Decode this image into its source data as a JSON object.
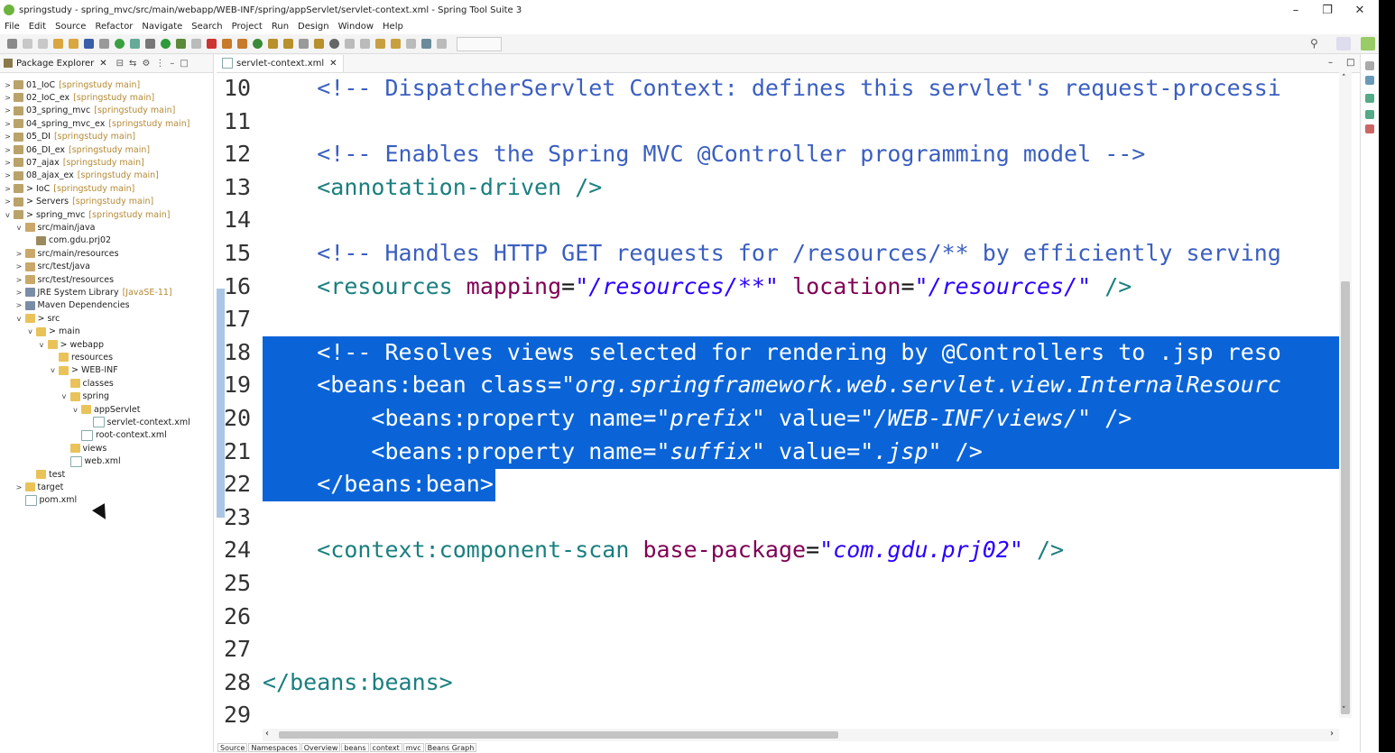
{
  "window": {
    "title": "springstudy - spring_mvc/src/main/webapp/WEB-INF/spring/appServlet/servlet-context.xml - Spring Tool Suite 3",
    "minimize": "–",
    "restore": "❐",
    "close": "✕"
  },
  "menu": [
    "File",
    "Edit",
    "Source",
    "Refactor",
    "Navigate",
    "Search",
    "Project",
    "Run",
    "Design",
    "Window",
    "Help"
  ],
  "package_explorer": {
    "title": "Package Explorer",
    "tree": [
      {
        "indent": 0,
        "tw": ">",
        "icon": "proj",
        "label": "01_IoC",
        "deco": "[springstudy main]"
      },
      {
        "indent": 0,
        "tw": ">",
        "icon": "proj",
        "label": "02_IoC_ex",
        "deco": "[springstudy main]"
      },
      {
        "indent": 0,
        "tw": ">",
        "icon": "proj",
        "label": "03_spring_mvc",
        "deco": "[springstudy main]"
      },
      {
        "indent": 0,
        "tw": ">",
        "icon": "proj",
        "label": "04_spring_mvc_ex",
        "deco": "[springstudy main]"
      },
      {
        "indent": 0,
        "tw": ">",
        "icon": "proj",
        "label": "05_DI",
        "deco": "[springstudy main]"
      },
      {
        "indent": 0,
        "tw": ">",
        "icon": "proj",
        "label": "06_DI_ex",
        "deco": "[springstudy main]"
      },
      {
        "indent": 0,
        "tw": ">",
        "icon": "proj",
        "label": "07_ajax",
        "deco": "[springstudy main]"
      },
      {
        "indent": 0,
        "tw": ">",
        "icon": "proj",
        "label": "08_ajax_ex",
        "deco": "[springstudy main]"
      },
      {
        "indent": 0,
        "tw": ">",
        "icon": "proj",
        "label": "> IoC",
        "deco": "[springstudy main]"
      },
      {
        "indent": 0,
        "tw": ">",
        "icon": "proj",
        "label": "> Servers",
        "deco": "[springstudy main]"
      },
      {
        "indent": 0,
        "tw": "v",
        "icon": "proj",
        "label": "> spring_mvc",
        "deco": "[springstudy main]"
      },
      {
        "indent": 1,
        "tw": "v",
        "icon": "src",
        "label": "src/main/java",
        "deco": ""
      },
      {
        "indent": 2,
        "tw": "",
        "icon": "pkgi",
        "label": "com.gdu.prj02",
        "deco": ""
      },
      {
        "indent": 1,
        "tw": ">",
        "icon": "src",
        "label": "src/main/resources",
        "deco": ""
      },
      {
        "indent": 1,
        "tw": ">",
        "icon": "src",
        "label": "src/test/java",
        "deco": ""
      },
      {
        "indent": 1,
        "tw": ">",
        "icon": "src",
        "label": "src/test/resources",
        "deco": ""
      },
      {
        "indent": 1,
        "tw": ">",
        "icon": "lib",
        "label": "JRE System Library",
        "deco": "[JavaSE-11]"
      },
      {
        "indent": 1,
        "tw": ">",
        "icon": "lib",
        "label": "Maven Dependencies",
        "deco": ""
      },
      {
        "indent": 1,
        "tw": "v",
        "icon": "folder",
        "label": "> src",
        "deco": ""
      },
      {
        "indent": 2,
        "tw": "v",
        "icon": "folder",
        "label": "> main",
        "deco": ""
      },
      {
        "indent": 3,
        "tw": "v",
        "icon": "folder",
        "label": "> webapp",
        "deco": ""
      },
      {
        "indent": 4,
        "tw": "",
        "icon": "folder",
        "label": "resources",
        "deco": ""
      },
      {
        "indent": 4,
        "tw": "v",
        "icon": "folder",
        "label": "> WEB-INF",
        "deco": ""
      },
      {
        "indent": 5,
        "tw": "",
        "icon": "folder",
        "label": "classes",
        "deco": ""
      },
      {
        "indent": 5,
        "tw": "v",
        "icon": "folder",
        "label": "spring",
        "deco": ""
      },
      {
        "indent": 6,
        "tw": "v",
        "icon": "folder",
        "label": "appServlet",
        "deco": ""
      },
      {
        "indent": 7,
        "tw": "",
        "icon": "xml",
        "label": "servlet-context.xml",
        "deco": ""
      },
      {
        "indent": 6,
        "tw": "",
        "icon": "xml",
        "label": "root-context.xml",
        "deco": ""
      },
      {
        "indent": 5,
        "tw": "",
        "icon": "folder",
        "label": "views",
        "deco": ""
      },
      {
        "indent": 5,
        "tw": "",
        "icon": "xml",
        "label": "web.xml",
        "deco": ""
      },
      {
        "indent": 2,
        "tw": "",
        "icon": "folder",
        "label": "test",
        "deco": ""
      },
      {
        "indent": 1,
        "tw": ">",
        "icon": "folder",
        "label": "target",
        "deco": ""
      },
      {
        "indent": 1,
        "tw": "",
        "icon": "xml",
        "label": "pom.xml",
        "deco": ""
      }
    ]
  },
  "editor": {
    "tab": "servlet-context.xml",
    "line_numbers": [
      "10",
      "11",
      "12",
      "13",
      "14",
      "15",
      "16",
      "17",
      "18",
      "19",
      "20",
      "21",
      "22",
      "23",
      "24",
      "25",
      "26",
      "27",
      "28",
      "29"
    ],
    "lines": [
      {
        "segs": [
          {
            "t": "    ",
            "c": "#111"
          },
          {
            "t": "<!-- DispatcherServlet Context: defines this servlet's request-processi",
            "c": "#3b5fc0"
          }
        ]
      },
      {
        "segs": []
      },
      {
        "segs": [
          {
            "t": "    ",
            "c": "#111"
          },
          {
            "t": "<!-- Enables the Spring MVC @Controller programming model -->",
            "c": "#3b5fc0"
          }
        ]
      },
      {
        "segs": [
          {
            "t": "    ",
            "c": "#111"
          },
          {
            "t": "<annotation-driven />",
            "c": "#1b7f7f"
          }
        ]
      },
      {
        "segs": []
      },
      {
        "segs": [
          {
            "t": "    ",
            "c": "#111"
          },
          {
            "t": "<!-- Handles HTTP GET requests for /resources/** by efficiently serving",
            "c": "#3b5fc0"
          }
        ]
      },
      {
        "segs": [
          {
            "t": "    ",
            "c": "#111"
          },
          {
            "t": "<resources ",
            "c": "#1b7f7f"
          },
          {
            "t": "mapping",
            "c": "#7f0055"
          },
          {
            "t": "=",
            "c": "#111"
          },
          {
            "t": "\"/resources/**\"",
            "c": "#2a00ff",
            "i": true
          },
          {
            "t": " location",
            "c": "#7f0055"
          },
          {
            "t": "=",
            "c": "#111"
          },
          {
            "t": "\"/resources/\"",
            "c": "#2a00ff",
            "i": true
          },
          {
            "t": " />",
            "c": "#1b7f7f"
          }
        ]
      },
      {
        "segs": []
      },
      {
        "sel": true,
        "segs": [
          {
            "t": "    <!-- Resolves views selected for rendering by @Controllers to .jsp reso",
            "c": "#fff"
          }
        ]
      },
      {
        "sel": true,
        "segs": [
          {
            "t": "    <beans:bean class=",
            "c": "#fff"
          },
          {
            "t": "\"org.springframework.web.servlet.view.InternalResourc",
            "c": "#fff",
            "i": true
          }
        ]
      },
      {
        "sel": true,
        "segs": [
          {
            "t": "        <beans:property name=",
            "c": "#fff"
          },
          {
            "t": "\"prefix\"",
            "c": "#fff",
            "i": true
          },
          {
            "t": " value=",
            "c": "#fff"
          },
          {
            "t": "\"/WEB-INF/views/\"",
            "c": "#fff",
            "i": true
          },
          {
            "t": " />",
            "c": "#fff"
          }
        ]
      },
      {
        "sel": true,
        "segs": [
          {
            "t": "        <beans:property name=",
            "c": "#fff"
          },
          {
            "t": "\"suffix\"",
            "c": "#fff",
            "i": true
          },
          {
            "t": " value=",
            "c": "#fff"
          },
          {
            "t": "\".jsp\"",
            "c": "#fff",
            "i": true
          },
          {
            "t": " />",
            "c": "#fff"
          }
        ]
      },
      {
        "selend": true,
        "segs": [
          {
            "t": "    </beans:bean>",
            "c": "#fff"
          }
        ]
      },
      {
        "segs": []
      },
      {
        "segs": [
          {
            "t": "    ",
            "c": "#111"
          },
          {
            "t": "<context:component-scan ",
            "c": "#1b7f7f"
          },
          {
            "t": "base-package",
            "c": "#7f0055"
          },
          {
            "t": "=",
            "c": "#111"
          },
          {
            "t": "\"com.gdu.prj02\"",
            "c": "#2a00ff",
            "i": true
          },
          {
            "t": " />",
            "c": "#1b7f7f"
          }
        ]
      },
      {
        "segs": []
      },
      {
        "segs": []
      },
      {
        "segs": []
      },
      {
        "segs": [
          {
            "t": "</beans:beans>",
            "c": "#1b7f7f"
          }
        ]
      },
      {
        "segs": []
      }
    ]
  },
  "bottom_tabs": [
    "Source",
    "Namespaces",
    "Overview",
    "beans",
    "context",
    "mvc",
    "Beans Graph"
  ]
}
